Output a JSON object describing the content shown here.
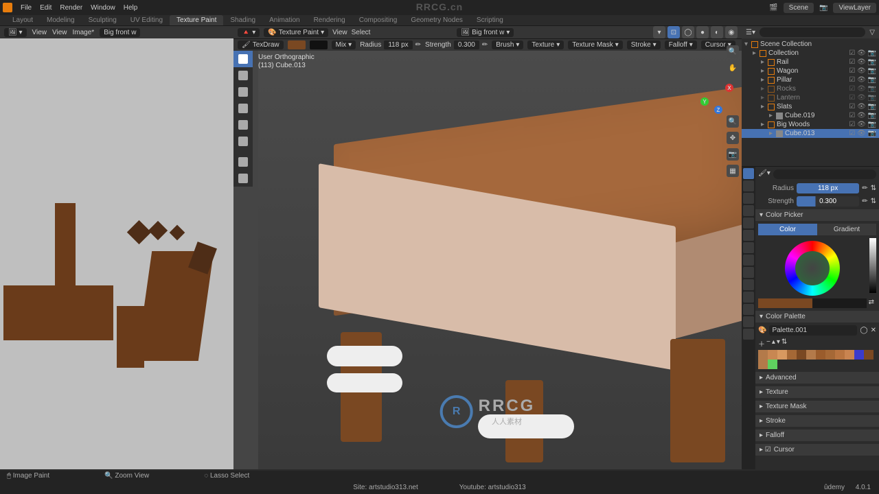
{
  "watermark": "RRCG.cn",
  "center_logo_text": "RRCG",
  "center_logo_sub": "人人素材",
  "top_menu": {
    "items": [
      "File",
      "Edit",
      "Render",
      "Window",
      "Help"
    ],
    "workspaces": [
      "Layout",
      "Modeling",
      "Sculpting",
      "UV Editing",
      "Texture Paint",
      "Shading",
      "Animation",
      "Rendering",
      "Compositing",
      "Geometry Nodes",
      "Scripting"
    ],
    "active_workspace": "Texture Paint",
    "scene": "Scene",
    "view_layer": "ViewLayer"
  },
  "uv": {
    "mode": "View",
    "mode2": "View",
    "image_label": "Image*",
    "image_name": "Big front w"
  },
  "vp_header": {
    "mode": "Texture Paint",
    "menus": [
      "View",
      "Select"
    ],
    "image": "Big front w"
  },
  "vp_header2": {
    "brush_name": "TexDraw",
    "blend": "Mix",
    "radius_label": "Radius",
    "radius_value": "118 px",
    "strength_label": "Strength",
    "strength_value": "0.300",
    "options": [
      "Brush",
      "Texture",
      "Texture Mask",
      "Stroke",
      "Falloff",
      "Cursor"
    ]
  },
  "vp_info": {
    "line1": "User Orthographic",
    "line2": "(113) Cube.013"
  },
  "outliner": {
    "root": "Scene Collection",
    "items": [
      {
        "name": "Collection",
        "indent": 1,
        "type": "coll"
      },
      {
        "name": "Rail",
        "indent": 2,
        "type": "coll"
      },
      {
        "name": "Wagon",
        "indent": 2,
        "type": "coll"
      },
      {
        "name": "Pillar",
        "indent": 2,
        "type": "coll"
      },
      {
        "name": "Rocks",
        "indent": 2,
        "type": "coll",
        "hidden": true
      },
      {
        "name": "Lantern",
        "indent": 2,
        "type": "coll",
        "hidden": true
      },
      {
        "name": "Slats",
        "indent": 2,
        "type": "coll"
      },
      {
        "name": "Cube.019",
        "indent": 3,
        "type": "mesh"
      },
      {
        "name": "Big Woods",
        "indent": 2,
        "type": "coll"
      },
      {
        "name": "Cube.013",
        "indent": 3,
        "type": "mesh",
        "selected": true
      }
    ]
  },
  "props": {
    "radius_label": "Radius",
    "radius_value": "118 px",
    "strength_label": "Strength",
    "strength_value": "0.300",
    "color_picker": "Color Picker",
    "color_tab": "Color",
    "gradient_tab": "Gradient",
    "palette_header": "Color Palette",
    "palette_name": "Palette.001",
    "sections": [
      "Advanced",
      "Texture",
      "Texture Mask",
      "Stroke",
      "Falloff",
      "Cursor"
    ],
    "palette_colors": [
      "#b37a4a",
      "#c88752",
      "#d89960",
      "#a56836",
      "#7a4822",
      "#b37a4a",
      "#9a5c2c",
      "#a56836",
      "#b87440",
      "#c98450",
      "#3b3bcc",
      "#7a4822",
      "#b37a4a",
      "#5fd05f"
    ]
  },
  "status": {
    "item1": "Image Paint",
    "item2": "Zoom View",
    "item3": "Lasso Select"
  },
  "footer": {
    "site": "Site: artstudio313.net",
    "yt": "Youtube: artstudio313",
    "version": "4.0.1",
    "udemy": "ûdemy"
  }
}
